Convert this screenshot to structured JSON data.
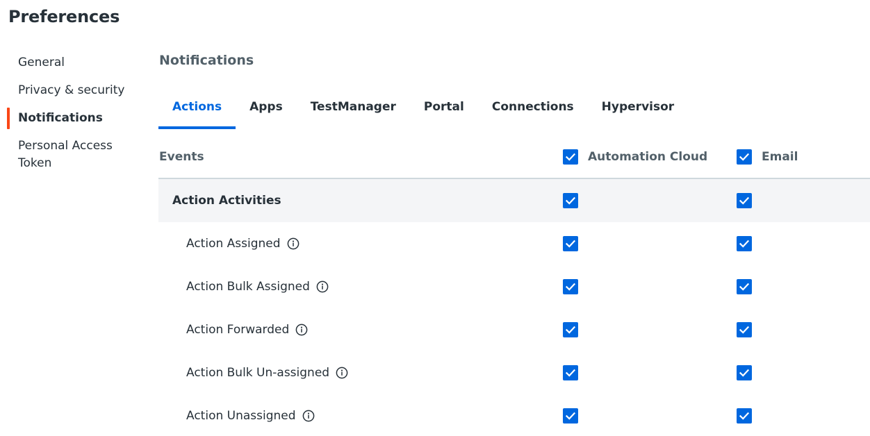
{
  "page": {
    "title": "Preferences"
  },
  "sidebar": {
    "items": [
      {
        "label": "General",
        "active": false
      },
      {
        "label": "Privacy & security",
        "active": false
      },
      {
        "label": "Notifications",
        "active": true
      },
      {
        "label": "Personal Access Token",
        "active": false
      }
    ],
    "accent_color": "#fa4616"
  },
  "main": {
    "section_title": "Notifications",
    "tabs": [
      {
        "label": "Actions",
        "active": true
      },
      {
        "label": "Apps",
        "active": false
      },
      {
        "label": "TestManager",
        "active": false
      },
      {
        "label": "Portal",
        "active": false
      },
      {
        "label": "Connections",
        "active": false
      },
      {
        "label": "Hypervisor",
        "active": false
      }
    ],
    "accent_color": "#0067df",
    "table": {
      "header": {
        "events_label": "Events",
        "col_automation_cloud": "Automation Cloud",
        "col_email": "Email",
        "automation_cloud_checked": true,
        "email_checked": true
      },
      "group": {
        "label": "Action Activities",
        "automation_cloud_checked": true,
        "email_checked": true
      },
      "rows": [
        {
          "label": "Action Assigned",
          "automation_cloud_checked": true,
          "email_checked": true,
          "info_icon": "info-icon"
        },
        {
          "label": "Action Bulk Assigned",
          "automation_cloud_checked": true,
          "email_checked": true,
          "info_icon": "info-icon"
        },
        {
          "label": "Action Forwarded",
          "automation_cloud_checked": true,
          "email_checked": true,
          "info_icon": "info-icon"
        },
        {
          "label": "Action Bulk Un-assigned",
          "automation_cloud_checked": true,
          "email_checked": true,
          "info_icon": "info-icon"
        },
        {
          "label": "Action Unassigned",
          "automation_cloud_checked": true,
          "email_checked": true,
          "info_icon": "info-icon"
        }
      ]
    }
  }
}
